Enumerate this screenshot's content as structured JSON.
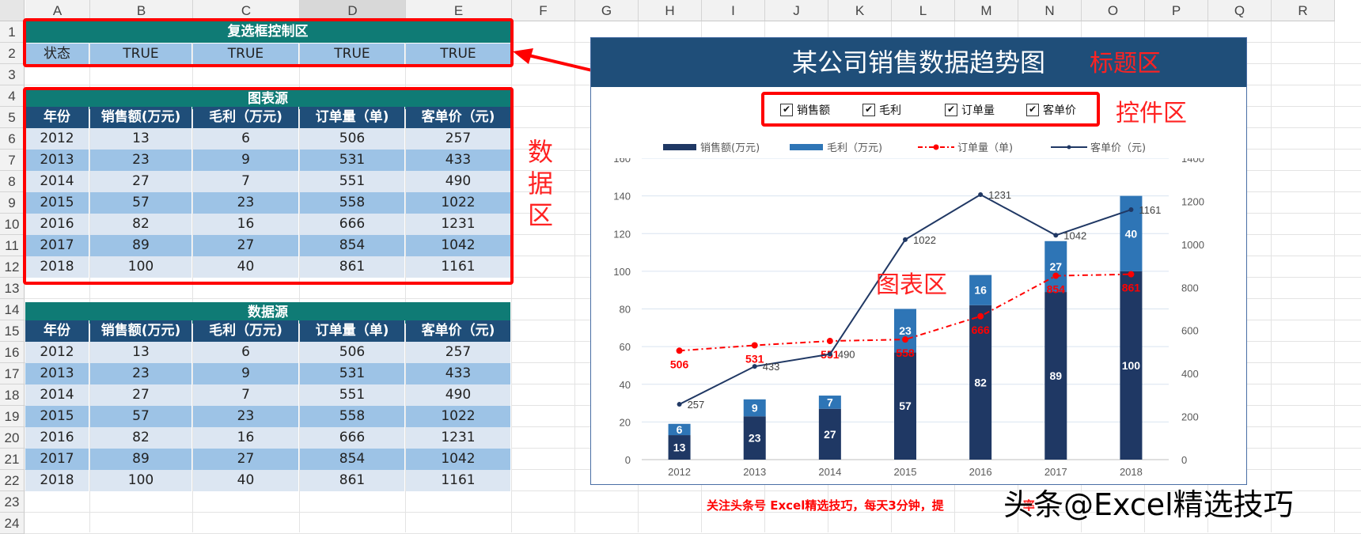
{
  "columns": [
    "A",
    "B",
    "C",
    "D",
    "E",
    "F",
    "G",
    "H",
    "I",
    "J",
    "K",
    "L",
    "M",
    "N",
    "O",
    "P",
    "Q",
    "R"
  ],
  "rows": [
    "1",
    "2",
    "3",
    "4",
    "5",
    "6",
    "7",
    "8",
    "9",
    "10",
    "11",
    "12",
    "13",
    "14",
    "15",
    "16",
    "17",
    "18",
    "19",
    "20",
    "21",
    "22",
    "23",
    "24"
  ],
  "control_area": {
    "title": "复选框控制区",
    "label": "状态",
    "values": [
      "TRUE",
      "TRUE",
      "TRUE",
      "TRUE"
    ]
  },
  "chart_source": {
    "title": "图表源",
    "headers": [
      "年份",
      "销售额(万元)",
      "毛利（万元)",
      "订单量（单)",
      "客单价（元)"
    ],
    "rows": [
      [
        "2012",
        "13",
        "6",
        "506",
        "257"
      ],
      [
        "2013",
        "23",
        "9",
        "531",
        "433"
      ],
      [
        "2014",
        "27",
        "7",
        "551",
        "490"
      ],
      [
        "2015",
        "57",
        "23",
        "558",
        "1022"
      ],
      [
        "2016",
        "82",
        "16",
        "666",
        "1231"
      ],
      [
        "2017",
        "89",
        "27",
        "854",
        "1042"
      ],
      [
        "2018",
        "100",
        "40",
        "861",
        "1161"
      ]
    ]
  },
  "data_source": {
    "title": "数据源",
    "headers": [
      "年份",
      "销售额(万元)",
      "毛利（万元)",
      "订单量（单)",
      "客单价（元)"
    ],
    "rows": [
      [
        "2012",
        "13",
        "6",
        "506",
        "257"
      ],
      [
        "2013",
        "23",
        "9",
        "531",
        "433"
      ],
      [
        "2014",
        "27",
        "7",
        "551",
        "490"
      ],
      [
        "2015",
        "57",
        "23",
        "558",
        "1022"
      ],
      [
        "2016",
        "82",
        "16",
        "666",
        "1231"
      ],
      [
        "2017",
        "89",
        "27",
        "854",
        "1042"
      ],
      [
        "2018",
        "100",
        "40",
        "861",
        "1161"
      ]
    ]
  },
  "annotations": {
    "title_area": "标题区",
    "control_zone": "控件区",
    "data_zone": [
      "数",
      "据",
      "区"
    ],
    "chart_zone": "图表区",
    "footer": "关注头条号 Excel精选技巧，每天3分钟，提",
    "footer_tail": "率",
    "watermark": "头条@Excel精选技巧"
  },
  "checkboxes": [
    {
      "label": "销售额",
      "checked": true
    },
    {
      "label": "毛利",
      "checked": true
    },
    {
      "label": "订单量",
      "checked": true
    },
    {
      "label": "客单价",
      "checked": true
    }
  ],
  "chart_data": {
    "type": "bar",
    "title": "某公司销售数据趋势图",
    "categories": [
      "2012",
      "2013",
      "2014",
      "2015",
      "2016",
      "2017",
      "2018"
    ],
    "series": [
      {
        "name": "销售额(万元)",
        "kind": "stacked-bar",
        "axis": "left",
        "color": "#1f3864",
        "values": [
          13,
          23,
          27,
          57,
          82,
          89,
          100
        ]
      },
      {
        "name": "毛利（万元)",
        "kind": "stacked-bar",
        "axis": "left",
        "color": "#2e75b6",
        "values": [
          6,
          9,
          7,
          23,
          16,
          27,
          40
        ]
      },
      {
        "name": "订单量（单)",
        "kind": "dashed-line",
        "axis": "right",
        "color": "#ff0000",
        "values": [
          506,
          531,
          551,
          558,
          666,
          854,
          861
        ]
      },
      {
        "name": "客单价（元)",
        "kind": "line",
        "axis": "right",
        "color": "#203864",
        "values": [
          257,
          433,
          490,
          1022,
          1231,
          1042,
          1161
        ]
      }
    ],
    "left_axis": {
      "ticks": [
        "0",
        "20",
        "40",
        "60",
        "80",
        "100",
        "120",
        "140",
        "160"
      ],
      "ylim": [
        0,
        160
      ]
    },
    "right_axis": {
      "ticks": [
        "0",
        "200",
        "400",
        "600",
        "800",
        "1000",
        "1200",
        "1400"
      ],
      "ylim": [
        0,
        1400
      ]
    },
    "legend": "top",
    "grid": true,
    "title_bg": "#1f4e79"
  }
}
